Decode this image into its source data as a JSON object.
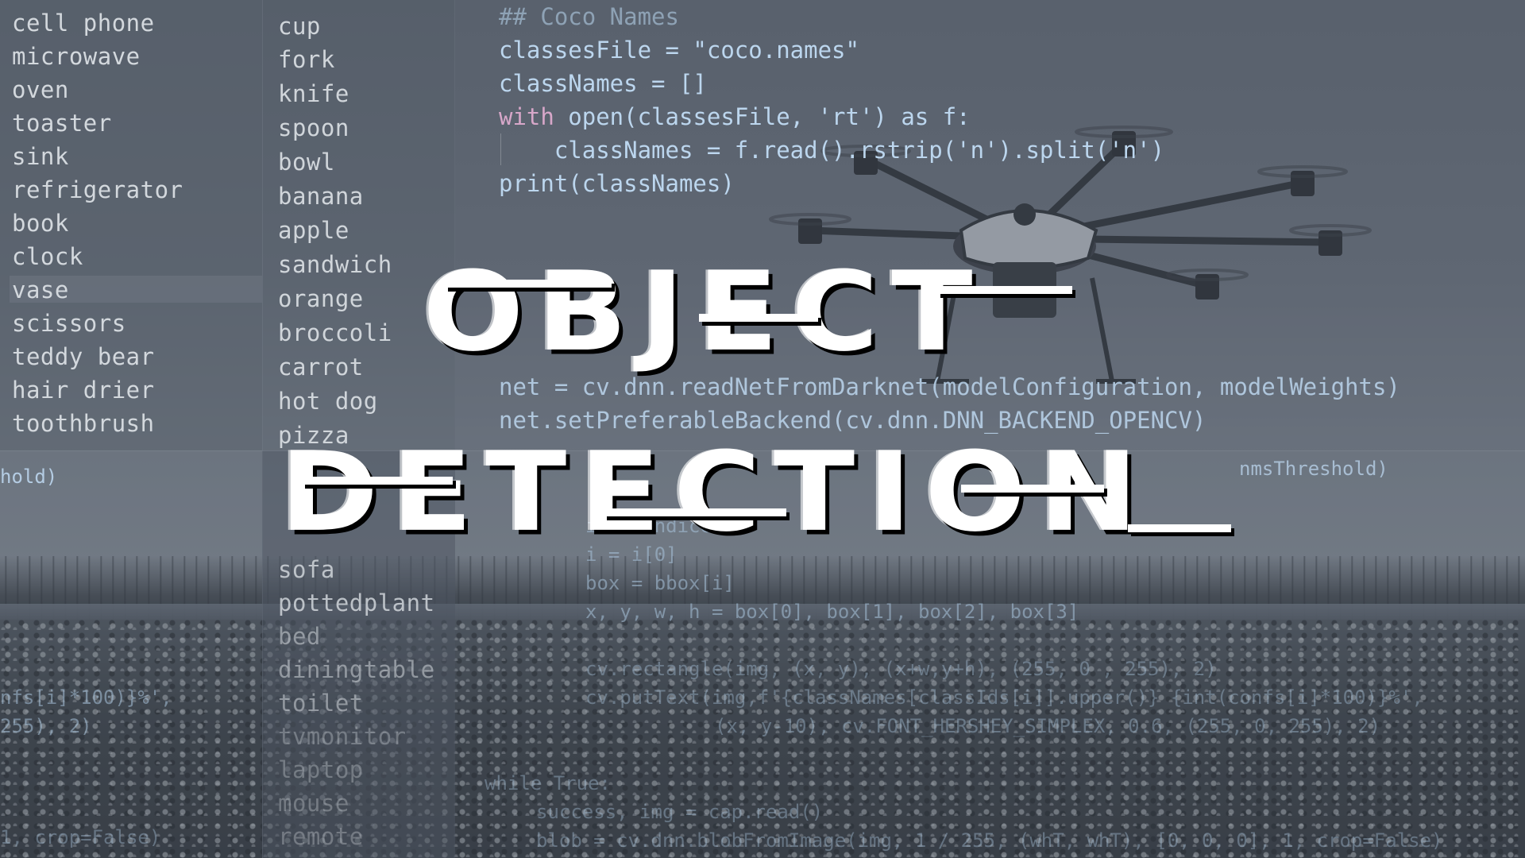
{
  "title": {
    "line1": "OBJECT",
    "line2": "DETECTION"
  },
  "class_list_left": [
    "cell phone",
    "microwave",
    "oven",
    "toaster",
    "sink",
    "refrigerator",
    "book",
    "clock",
    "vase",
    "scissors",
    "teddy bear",
    "hair drier",
    "toothbrush"
  ],
  "class_list_mid": [
    "cup",
    "fork",
    "knife",
    "spoon",
    "bowl",
    "banana",
    "apple",
    "sandwich",
    "orange",
    "broccoli",
    "carrot",
    "hot dog",
    "pizza"
  ],
  "class_list_mid_lower": [
    "sofa",
    "pottedplant",
    "bed",
    "diningtable",
    "toilet",
    "tvmonitor",
    "laptop",
    "mouse",
    "remote"
  ],
  "code_top": {
    "comment": "## Coco Names",
    "line1": "classesFile = \"coco.names\"",
    "line2": "classNames = []",
    "line3_kw": "with",
    "line3_rest": " open(classesFile, 'rt') as f:",
    "line4": "    classNames = f.read().rstrip('n').split('n')",
    "line5": "print(classNames)"
  },
  "code_mid": {
    "line1": "net = cv.dnn.readNetFromDarknet(modelConfiguration, modelWeights)",
    "line2": "net.setPreferableBackend(cv.dnn.DNN_BACKEND_OPENCV)",
    "line3": "nmsThreshold)"
  },
  "code_lower": {
    "left_frag1": "hold)",
    "left_frag2": "nfs[i]*100)}%',",
    "left_frag3": "255), 2)",
    "left_frag4": "1, crop=False)",
    "line1": "i in indices:",
    "line2": "i = i[0]",
    "line3": "box = bbox[i]",
    "line4": "x, y, w, h = box[0], box[1], box[2], box[3]",
    "line5": "cv.rectangle(img, (x, y), (x+w,y+h), (255, 0 , 255), 2)",
    "line6": "cv.putText(img,f'{classNames[classIds[i]].upper()} {int(confs[i]*100)}%',",
    "line7": "(x, y-10), cv.FONT_HERSHEY_SIMPLEX, 0.6, (255, 0, 255), 2)",
    "line8": "while True:",
    "line9": "success, img = cap.read()",
    "line10": "blob = cv.dnn.blobFromImage(img, 1 / 255, (whT, whT), [0, 0, 0], 1, crop=False)"
  },
  "colors": {
    "title": "#ffffff",
    "title_shadow": "#000000",
    "code_text": "#bcd6ee",
    "keyword": "#d7a7c9",
    "string": "#cbb79b"
  }
}
